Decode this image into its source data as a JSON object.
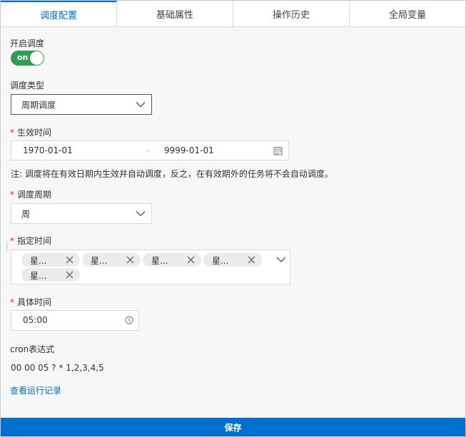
{
  "tabs": [
    {
      "label": "调度配置",
      "active": true
    },
    {
      "label": "基础属性",
      "active": false
    },
    {
      "label": "操作历史",
      "active": false
    },
    {
      "label": "全局变量",
      "active": false
    }
  ],
  "enable": {
    "label": "开启调度",
    "toggle_text": "on",
    "state": "on"
  },
  "schedule_type": {
    "label": "调度类型",
    "value": "周期调度"
  },
  "effective": {
    "required_mark": "*",
    "label": "生效时间",
    "start": "1970-01-01",
    "separator": "-",
    "end": "9999-01-01"
  },
  "note": "注: 调度将在有效日期内生效并自动调度，反之，在有效期外的任务将不会自动调度。",
  "cycle": {
    "required_mark": "*",
    "label": "调度周期",
    "value": "周"
  },
  "specify": {
    "required_mark": "*",
    "label": "指定时间",
    "tags": [
      "星...",
      "星...",
      "星...",
      "星...",
      "星..."
    ]
  },
  "specific_time": {
    "required_mark": "*",
    "label": "具体时间",
    "value": "05:00"
  },
  "cron": {
    "label": "cron表达式",
    "value": "00 00 05 ? * 1,2,3,4,5"
  },
  "run_log_link": "查看运行记录",
  "save_button": "保存",
  "colors": {
    "accent": "#0070cc",
    "toggle_on": "#2e9e4f",
    "required": "#e1251b"
  }
}
